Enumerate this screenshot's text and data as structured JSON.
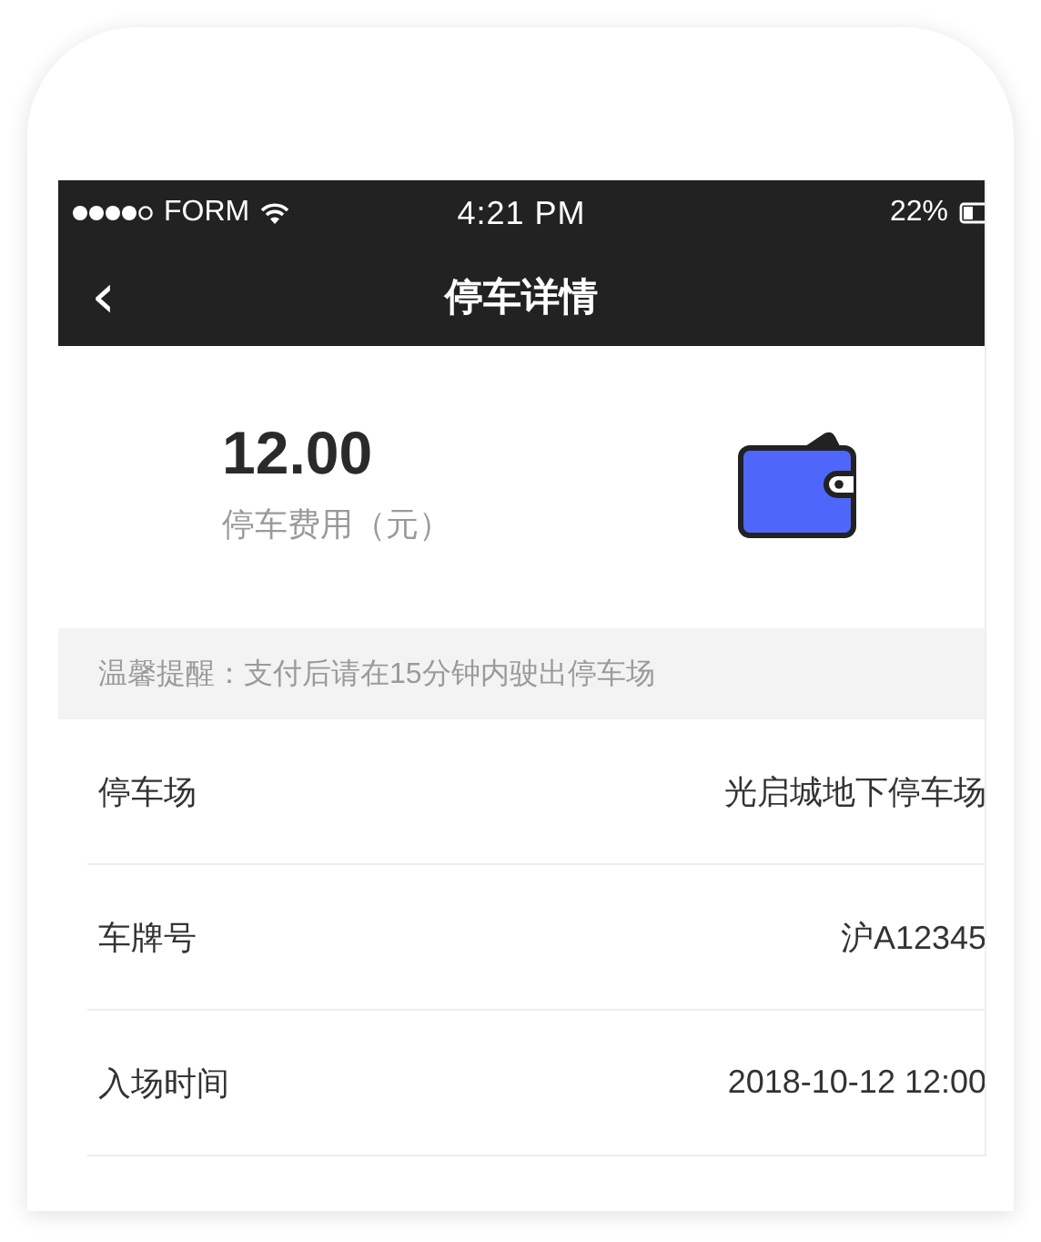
{
  "status_bar": {
    "carrier": "FORM",
    "time": "4:21 PM",
    "battery": "22%"
  },
  "nav": {
    "back": "‹",
    "title": "停车详情"
  },
  "fee": {
    "amount": "12.00",
    "label": "停车费用（元）"
  },
  "tip": "温馨提醒：支付后请在15分钟内驶出停车场",
  "rows": [
    {
      "label": "停车场",
      "value": "光启城地下停车场"
    },
    {
      "label": "车牌号",
      "value": "沪A12345"
    },
    {
      "label": "入场时间",
      "value": "2018-10-12 12:00"
    }
  ]
}
